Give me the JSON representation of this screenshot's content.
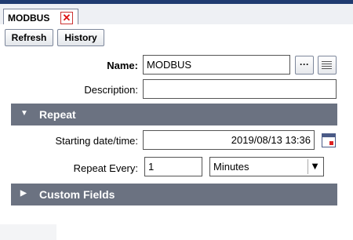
{
  "tab": {
    "title": "MODBUS",
    "close_glyph": "✕"
  },
  "toolbar": {
    "refresh_label": "Refresh",
    "history_label": "History"
  },
  "form": {
    "name_label": "Name:",
    "name_value": "MODBUS",
    "name_browse_glyph": "···",
    "description_label": "Description:",
    "description_value": ""
  },
  "repeat_section": {
    "title": "Repeat",
    "arrow_glyph": "▼",
    "start_label": "Starting date/time:",
    "start_value": "2019/08/13 13:36",
    "every_label": "Repeat Every:",
    "every_value": "1",
    "unit_value": "Minutes",
    "dropdown_glyph": "▼"
  },
  "custom_section": {
    "title": "Custom Fields",
    "arrow_glyph": "▶"
  },
  "colors": {
    "section_header": "#6b7281",
    "close_red": "#dd1111",
    "top_bar": "#1f3b70"
  }
}
